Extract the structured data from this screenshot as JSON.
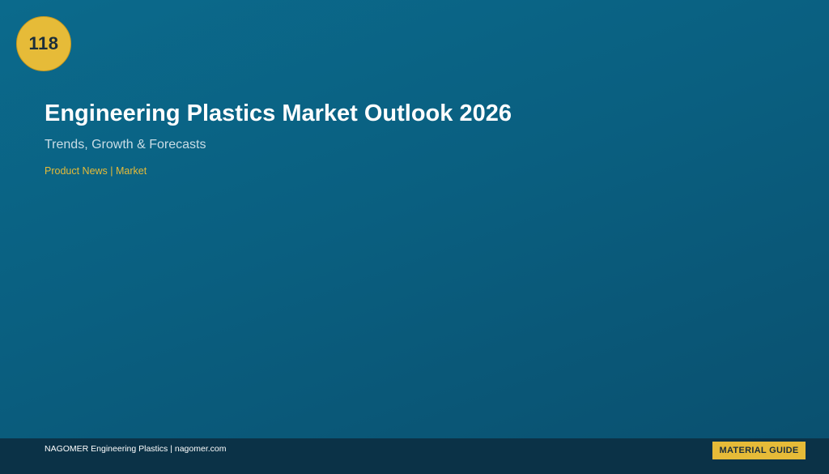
{
  "badge": {
    "number": "118"
  },
  "article": {
    "title": "Engineering Plastics Market Outlook 2026",
    "subtitle": "Trends, Growth & Forecasts",
    "category": "Product News | Market"
  },
  "footer": {
    "brand": "NAGOMER Engineering Plastics | nagomer.com",
    "tag": "MATERIAL GUIDE"
  },
  "colors": {
    "background": "#0a5f80",
    "accent": "#e6bb38",
    "footer": "#0b3247"
  }
}
